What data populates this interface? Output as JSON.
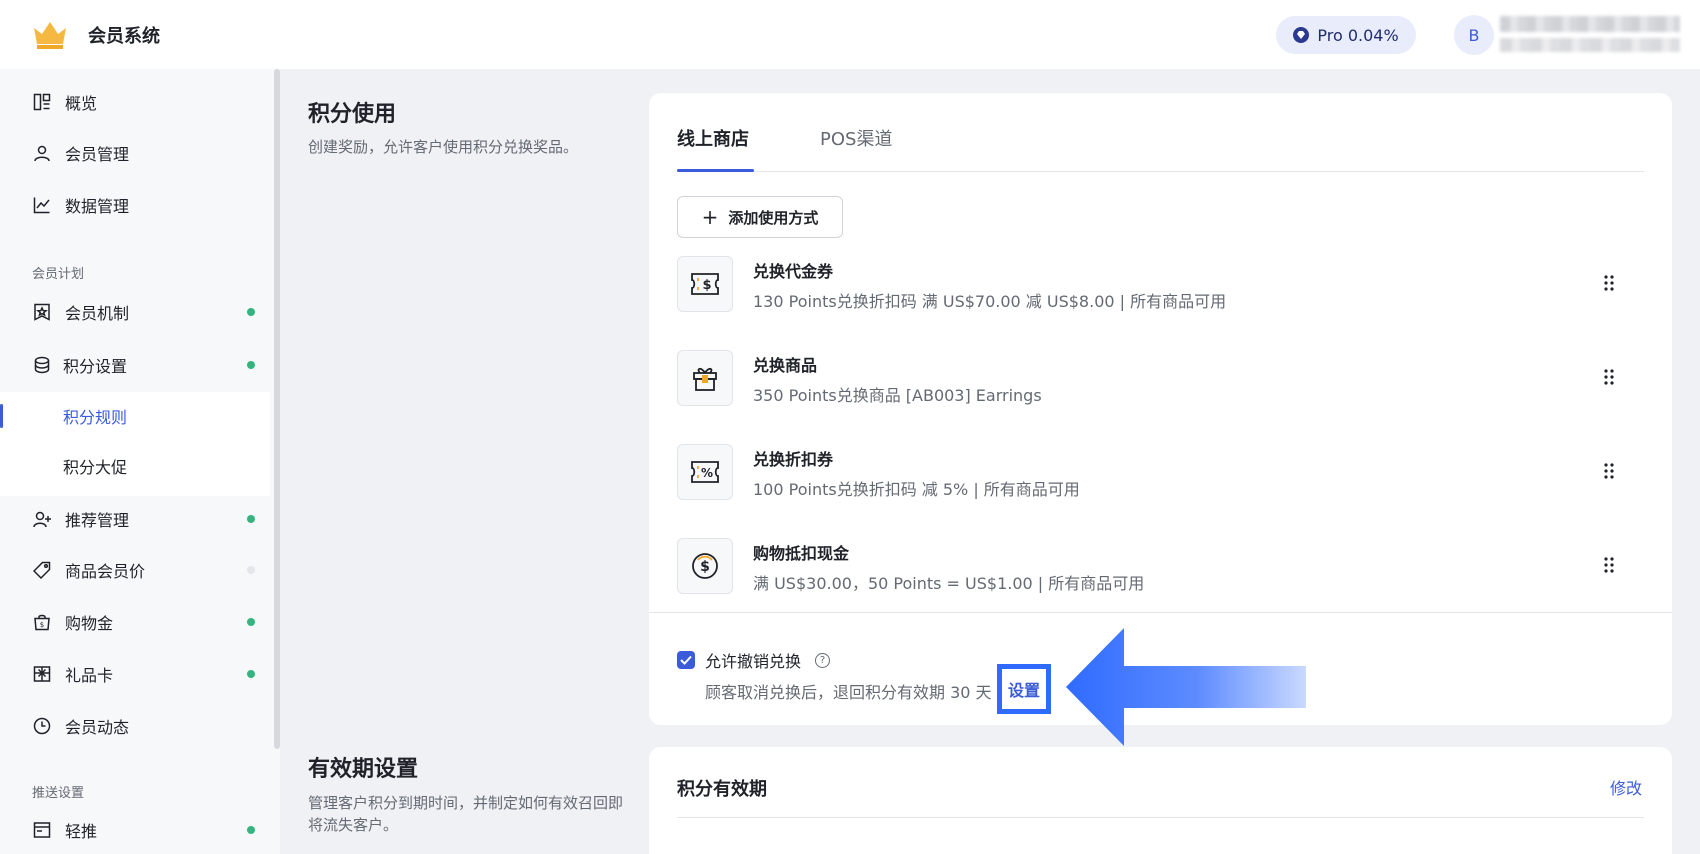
{
  "header": {
    "app_title": "会员系统",
    "pro_label": "Pro 0.04%",
    "avatar_initial": "B"
  },
  "sidebar": {
    "items_top": [
      {
        "label": "概览",
        "icon": "dashboard-icon"
      },
      {
        "label": "会员管理",
        "icon": "user-icon"
      },
      {
        "label": "数据管理",
        "icon": "line-chart-icon"
      }
    ],
    "group_member_plan": "会员计划",
    "items_plan": [
      {
        "label": "会员机制",
        "icon": "badge-icon",
        "status": "active"
      },
      {
        "label": "积分设置",
        "icon": "coins-icon",
        "status": "active"
      }
    ],
    "sub_items": [
      {
        "label": "积分规则",
        "selected": true
      },
      {
        "label": "积分大促",
        "selected": false
      }
    ],
    "items_more": [
      {
        "label": "推荐管理",
        "icon": "user-plus-icon",
        "status": "active"
      },
      {
        "label": "商品会员价",
        "icon": "tag-icon",
        "status": "inactive"
      },
      {
        "label": "购物金",
        "icon": "shopping-bag-icon",
        "status": "active"
      },
      {
        "label": "礼品卡",
        "icon": "gift-card-icon",
        "status": "active"
      },
      {
        "label": "会员动态",
        "icon": "clock-icon",
        "status": "none"
      }
    ],
    "group_push": "推送设置",
    "items_push": [
      {
        "label": "轻推",
        "icon": "window-icon",
        "status": "active"
      }
    ]
  },
  "points_usage": {
    "title": "积分使用",
    "description": "创建奖励，允许客户使用积分兑换奖品。",
    "tabs": [
      {
        "label": "线上商店",
        "active": true
      },
      {
        "label": "POS渠道",
        "active": false
      }
    ],
    "add_button": "添加使用方式",
    "rewards": [
      {
        "title": "兑换代金券",
        "description": "130 Points兑换折扣码 满 US$70.00 减 US$8.00 | 所有商品可用",
        "icon": "voucher-dollar-icon"
      },
      {
        "title": "兑换商品",
        "description": "350 Points兑换商品 [AB003] Earrings",
        "icon": "gift-box-icon"
      },
      {
        "title": "兑换折扣券",
        "description": "100 Points兑换折扣码 减 5% | 所有商品可用",
        "icon": "voucher-percent-icon"
      },
      {
        "title": "购物抵扣现金",
        "description": "满 US$30.00，50 Points = US$1.00 | 所有商品可用",
        "icon": "coin-dollar-icon"
      }
    ],
    "allow_cancel_label": "允许撤销兑换",
    "allow_cancel_checked": true,
    "cancel_desc": "顾客取消兑换后，退回积分有效期 30 天",
    "settings_link": "设置"
  },
  "expiry": {
    "title": "有效期设置",
    "description": "管理客户积分到期时间，并制定如何有效召回即将流失客户。",
    "card_title": "积分有效期",
    "edit_link": "修改"
  },
  "colors": {
    "accent": "#3b5bdb",
    "status_green": "#36b37e",
    "highlight_arrow": "#2f6bff"
  }
}
